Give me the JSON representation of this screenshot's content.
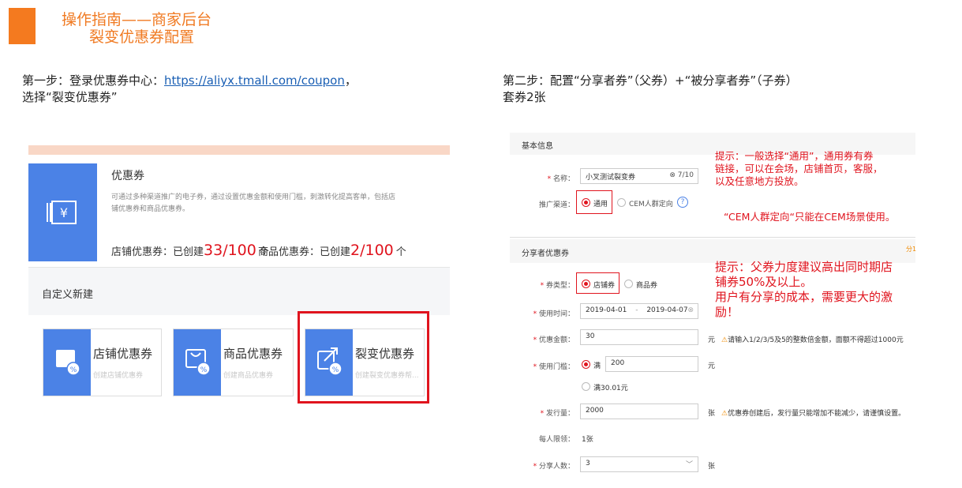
{
  "header": {
    "title_line1": "操作指南——商家后台",
    "title_line2": "裂变优惠券配置"
  },
  "step1": {
    "text_before": "第一步：登录优惠券中心：",
    "link": "https://aliyx.tmall.com/coupon",
    "text_after": "，",
    "line2": "选择“裂变优惠券”"
  },
  "step2": {
    "line1": "第二步：配置“分享者券”（父券）+“被分享者券”（子券）",
    "line2": "套券2张"
  },
  "left_panel": {
    "coupon_title": "优惠券",
    "coupon_desc_line1": "可通过多种渠道推广的电子券，通过设置优惠金额和使用门槛，刺激转化提高客单，包括店",
    "coupon_desc_line2": "铺优惠券和商品优惠券。",
    "shop_stat_label": "店铺优惠券：已创建",
    "shop_stat_value": "33/100",
    "shop_stat_unit": "个",
    "item_stat_label": "商品优惠券：已创建",
    "item_stat_value": "2/100",
    "item_stat_unit": "个",
    "section_title": "自定义新建",
    "cards": [
      {
        "label": "店铺优惠券",
        "sub": "创建店铺优惠券"
      },
      {
        "label": "商品优惠券",
        "sub": "创建商品优惠券"
      },
      {
        "label": "裂变优惠券",
        "sub": "创建裂变优惠券帮..."
      }
    ]
  },
  "right_panel": {
    "basic_info_title": "基本信息",
    "name_label": "名称：",
    "name_value": "小叉测试裂变券",
    "name_count": "7/10",
    "channel_label": "推广渠道：",
    "channel_options": [
      "通用",
      "CEM人群定向"
    ],
    "tip1_line1": "提示：一般选择“通用”，通用券有券",
    "tip1_line2": "链接，可以在会场，店铺首页，客服，",
    "tip1_line3": "以及任意地方投放。",
    "tip2": "“CEM人群定向“只能在CEM场景使用。",
    "sharer_title": "分享者优惠券",
    "sharer_corner": "分1",
    "type_label": "券类型：",
    "type_options": [
      "店铺券",
      "商品券"
    ],
    "tip3_line1": "提示：父券力度建议高出同时期店",
    "tip3_line2": "铺券50%及以上。",
    "tip3_line3": "用户有分享的成本，需要更大的激",
    "tip3_line4": "励！",
    "time_label": "使用时间：",
    "time_start": "2019-04-01",
    "time_sep": "-",
    "time_end": "2019-04-07",
    "amount_label": "优惠金额：",
    "amount_value": "30",
    "amount_unit": "元",
    "amount_hint": "请输入1/2/3/5及5的整数倍金额，面额不得超过1000元",
    "threshold_label": "使用门槛：",
    "threshold_opt1": "满",
    "threshold_value": "200",
    "threshold_unit": "元",
    "threshold_opt2": "满30.01元",
    "issue_label": "发行量：",
    "issue_value": "2000",
    "issue_unit": "张",
    "issue_hint": "优惠券创建后，发行量只能增加不能减少，请谨慎设置。",
    "limit_label": "每人限领：",
    "limit_value": "1张",
    "share_label": "分享人数：",
    "share_value": "3",
    "share_unit": "张"
  }
}
